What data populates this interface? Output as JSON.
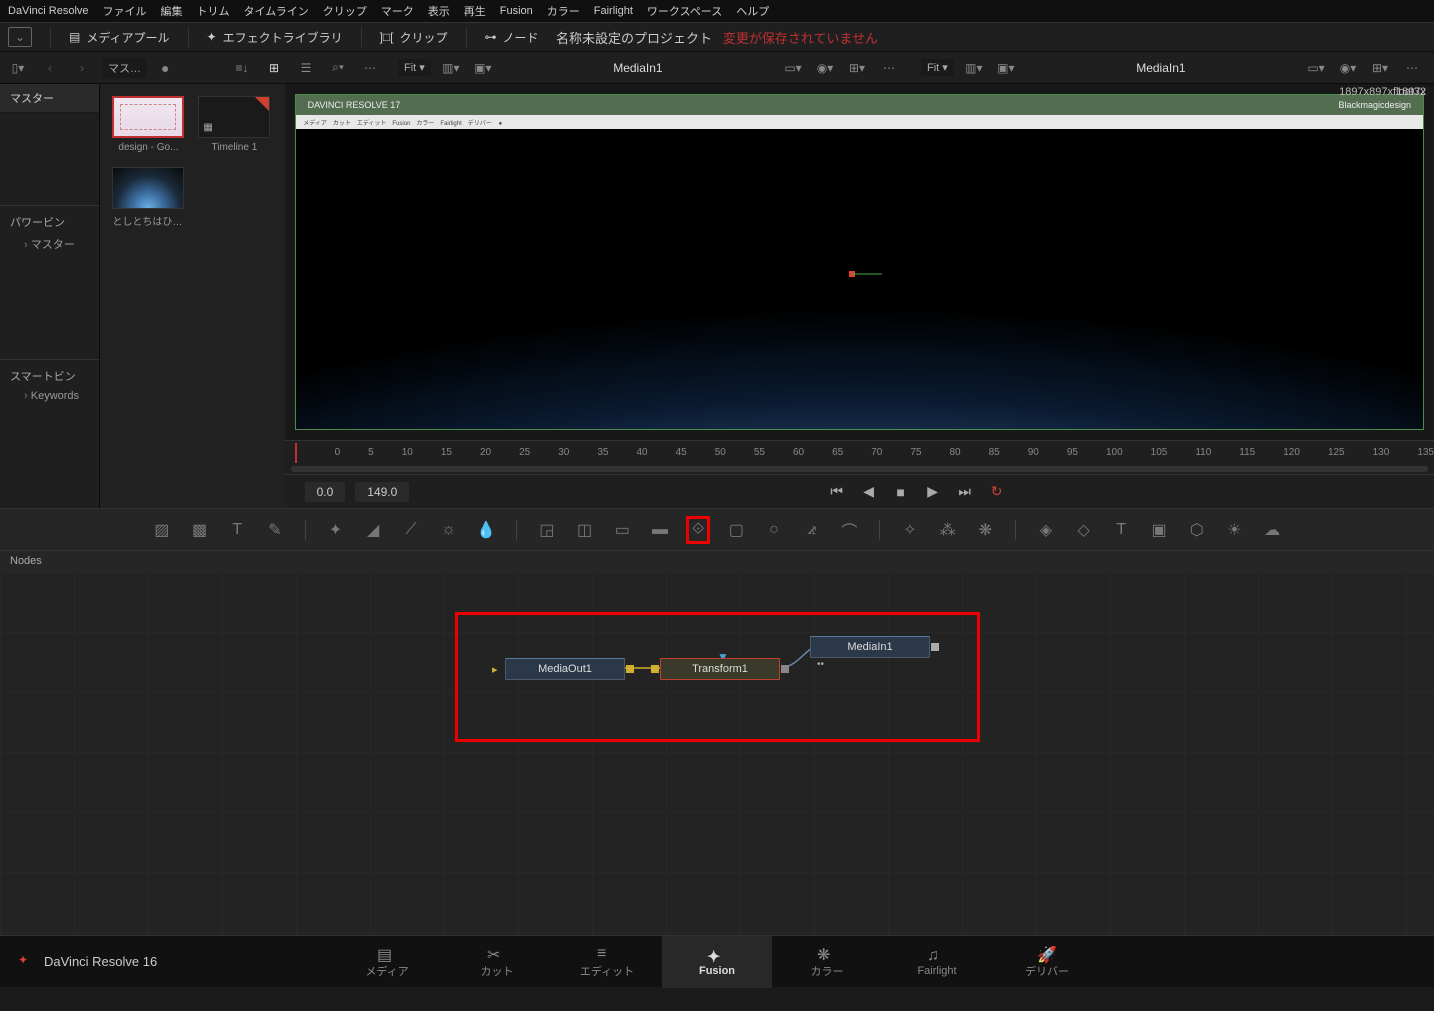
{
  "menubar": [
    "DaVinci Resolve",
    "ファイル",
    "編集",
    "トリム",
    "タイムライン",
    "クリップ",
    "マーク",
    "表示",
    "再生",
    "Fusion",
    "カラー",
    "Fairlight",
    "ワークスペース",
    "ヘルプ"
  ],
  "toolbar": {
    "media_pool": "メディアプール",
    "effects": "エフェクトライブラリ",
    "clips": "クリップ",
    "nodes_btn": "ノード",
    "project_title": "名称未設定のプロジェクト",
    "unsaved": "変更が保存されていません"
  },
  "sidebar": {
    "bin_dropdown": "マス…",
    "master_tab": "マスター",
    "power_bin": "パワービン",
    "power_item": "マスター",
    "smart_bin": "スマートビン",
    "smart_item": "Keywords"
  },
  "media": {
    "clip1": "design - Go...",
    "clip2": "Timeline 1",
    "clip3": "としとちはひを ..."
  },
  "viewer1": {
    "fit": "Fit ▾",
    "title": "MediaIn1",
    "info": "1897x897xfloat32",
    "header_app": "DAVINCI RESOLVE 17",
    "header_brand": "Blackmagicdesign"
  },
  "viewer2": {
    "fit": "Fit ▾",
    "title": "MediaIn1",
    "info": "1897x",
    "header_app": "DAVINCI RESOLVE 17",
    "header_brand": "Blackmagicdesign"
  },
  "ruler_ticks": [
    "0",
    "5",
    "10",
    "15",
    "20",
    "25",
    "30",
    "35",
    "40",
    "45",
    "50",
    "55",
    "60",
    "65",
    "70",
    "75",
    "80",
    "85",
    "90",
    "95",
    "100",
    "105",
    "110",
    "115",
    "120",
    "125",
    "130",
    "135"
  ],
  "transport": {
    "t_in": "0.0",
    "t_out": "149.0"
  },
  "nodes_panel": {
    "header": "Nodes"
  },
  "nodes": {
    "n1": "MediaOut1",
    "n2": "Transform1",
    "n3": "MediaIn1"
  },
  "pages": {
    "media": "メディア",
    "cut": "カット",
    "edit": "エディット",
    "fusion": "Fusion",
    "color": "カラー",
    "fairlight": "Fairlight",
    "deliver": "デリバー",
    "app": "DaVinci Resolve 16"
  }
}
